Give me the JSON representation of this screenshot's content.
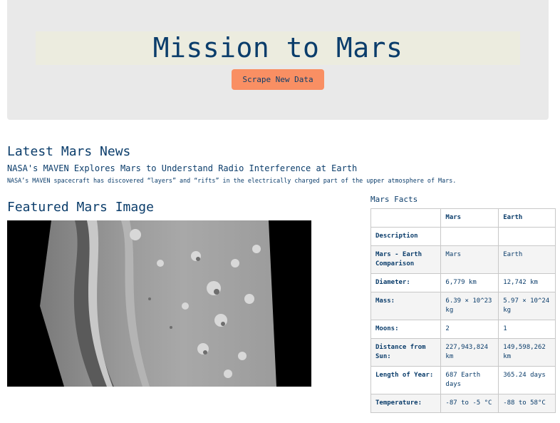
{
  "header": {
    "title": "Mission to Mars",
    "scrape_label": "Scrape New Data"
  },
  "news": {
    "heading": "Latest Mars News",
    "title": "NASA's MAVEN Explores Mars to Understand Radio Interference at Earth",
    "teaser": "NASA’s MAVEN spacecraft has discovered “layers” and “rifts” in the electrically charged part of the upper atmosphere of Mars."
  },
  "featured": {
    "heading": "Featured Mars Image"
  },
  "facts": {
    "heading": "Mars Facts",
    "columns": [
      "",
      "Mars",
      "Earth"
    ],
    "rows": [
      {
        "label": "Description",
        "mars": "",
        "earth": ""
      },
      {
        "label": "Mars - Earth Comparison",
        "mars": "Mars",
        "earth": "Earth"
      },
      {
        "label": "Diameter:",
        "mars": "6,779 km",
        "earth": "12,742 km"
      },
      {
        "label": "Mass:",
        "mars": "6.39 × 10^23 kg",
        "earth": "5.97 × 10^24 kg"
      },
      {
        "label": "Moons:",
        "mars": "2",
        "earth": "1"
      },
      {
        "label": "Distance from Sun:",
        "mars": "227,943,824 km",
        "earth": "149,598,262 km"
      },
      {
        "label": "Length of Year:",
        "mars": "687 Earth days",
        "earth": "365.24 days"
      },
      {
        "label": "Temperature:",
        "mars": "-87 to -5 °C",
        "earth": "-88 to 58°C"
      }
    ]
  }
}
